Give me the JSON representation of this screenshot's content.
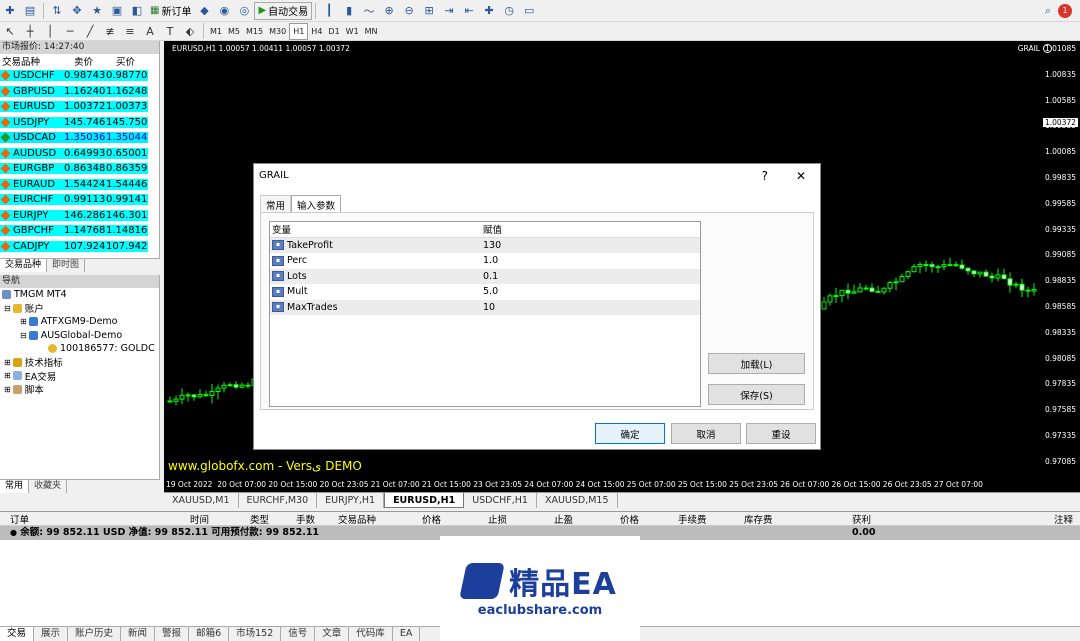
{
  "toolbar": {
    "new_order": "新订单",
    "auto_trading": "自动交易",
    "timeframes": [
      "M1",
      "M5",
      "M15",
      "M30",
      "H1",
      "H4",
      "D1",
      "W1",
      "MN"
    ],
    "active_timeframe": "H1",
    "notification_count": "1"
  },
  "market_watch": {
    "title": "市场报价: 14:27:40",
    "col_symbol": "交易品种",
    "col_bid": "卖价",
    "col_ask": "买价",
    "rows": [
      {
        "symbol": "USDCHF",
        "bid": "0.98743",
        "ask": "0.98770"
      },
      {
        "symbol": "GBPUSD",
        "bid": "1.16240",
        "ask": "1.16248"
      },
      {
        "symbol": "EURUSD",
        "bid": "1.00372",
        "ask": "1.00373"
      },
      {
        "symbol": "USDJPY",
        "bid": "145.746",
        "ask": "145.750"
      },
      {
        "symbol": "USDCAD",
        "bid": "1.35036",
        "ask": "1.35044"
      },
      {
        "symbol": "AUDUSD",
        "bid": "0.64993",
        "ask": "0.65001"
      },
      {
        "symbol": "EURGBP",
        "bid": "0.86348",
        "ask": "0.86359"
      },
      {
        "symbol": "EURAUD",
        "bid": "1.54424",
        "ask": "1.54446"
      },
      {
        "symbol": "EURCHF",
        "bid": "0.99113",
        "ask": "0.99141"
      },
      {
        "symbol": "EURJPY",
        "bid": "146.286",
        "ask": "146.301"
      },
      {
        "symbol": "GBPCHF",
        "bid": "1.14768",
        "ask": "1.14816"
      },
      {
        "symbol": "CADJPY",
        "bid": "107.924",
        "ask": "107.942"
      }
    ],
    "tabs": [
      "交易品种",
      "即时图"
    ]
  },
  "navigator": {
    "title": "导航",
    "items": [
      "TMGM MT4",
      "账户",
      "ATFXGM9-Demo",
      "AUSGlobal-Demo",
      "100186577: GOLDC",
      "技术指标",
      "EA交易",
      "脚本"
    ],
    "tabs": [
      "常用",
      "收藏夹"
    ]
  },
  "chart": {
    "header": "EURUSD,H1  1.00057 1.00411 1.00057 1.00372",
    "ea_label": "GRAIL",
    "price_tag": "1.00372",
    "watermark": "www.globofx.com - Versى DEMO",
    "y_ticks": [
      "1.01085",
      "1.00835",
      "1.00585",
      "1.00335",
      "1.00085",
      "0.99835",
      "0.99585",
      "0.99335",
      "0.99085",
      "0.98835",
      "0.98585",
      "0.98335",
      "0.98085",
      "0.97835",
      "0.97585",
      "0.97335",
      "0.97085"
    ],
    "x_ticks": [
      "19 Oct 2022",
      "20 Oct 07:00",
      "20 Oct 15:00",
      "20 Oct 23:05",
      "21 Oct 07:00",
      "21 Oct 15:00",
      "23 Oct 23:05",
      "24 Oct 07:00",
      "24 Oct 15:00",
      "25 Oct 07:00",
      "25 Oct 15:00",
      "25 Oct 23:05",
      "26 Oct 07:00",
      "26 Oct 15:00",
      "26 Oct 23:05",
      "27 Oct 07:00"
    ]
  },
  "chart_tabs": [
    "XAUUSD,M1",
    "EURCHF,M30",
    "EURJPY,H1",
    "EURUSD,H1",
    "USDCHF,H1",
    "XAUUSD,M15"
  ],
  "chart_tabs_active": 3,
  "dialog": {
    "title": "GRAIL",
    "help": "?",
    "close": "✕",
    "tabs": [
      "常用",
      "输入参数"
    ],
    "col_var": "变量",
    "col_val": "赋值",
    "params": [
      {
        "name": "TakeProfit",
        "value": "130"
      },
      {
        "name": "Perc",
        "value": "1.0"
      },
      {
        "name": "Lots",
        "value": "0.1"
      },
      {
        "name": "Mult",
        "value": "5.0"
      },
      {
        "name": "MaxTrades",
        "value": "10"
      }
    ],
    "load": "加载(L)",
    "save": "保存(S)",
    "ok": "确定",
    "cancel": "取消",
    "reset": "重设"
  },
  "terminal": {
    "columns": [
      "订单",
      "时间",
      "类型",
      "手数",
      "交易品种",
      "价格",
      "止损",
      "止盈",
      "价格",
      "手续费",
      "库存费",
      "获利",
      "注释"
    ],
    "balance": "余额: 99 852.11 USD  净值: 99 852.11  可用预付款: 99 852.11",
    "profit": "0.00",
    "tabs": [
      "交易",
      "展示",
      "账户历史",
      "新闻",
      "警报",
      "邮箱6",
      "市场152",
      "信号",
      "文章",
      "代码库",
      "EA"
    ]
  },
  "brand": {
    "name": "精品EA",
    "site": "eaclubshare.com"
  }
}
